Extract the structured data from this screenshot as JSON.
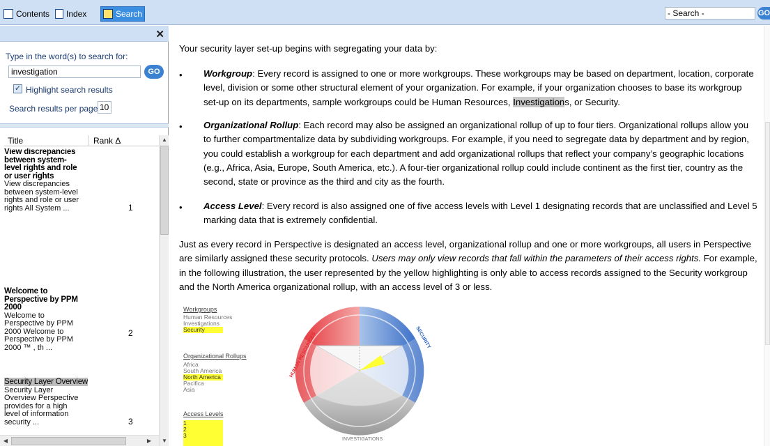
{
  "toolbar": {
    "tabs": [
      {
        "label": "Contents",
        "active": false,
        "icon": "book-icon"
      },
      {
        "label": "Index",
        "active": false,
        "icon": "index-icon"
      },
      {
        "label": "Search",
        "active": true,
        "icon": "search-icon"
      }
    ],
    "search_placeholder": "- Search -",
    "go_label": "GO"
  },
  "search_pane": {
    "prompt": "Type in the word(s) to search for:",
    "query": "investigation",
    "go_label": "GO",
    "highlight_label": "Highlight search results",
    "highlight_checked": true,
    "per_page_label": "Search results per page",
    "per_page_value": "10",
    "columns": {
      "title": "Title",
      "rank": "Rank Δ"
    },
    "results": [
      {
        "title": "View discrepancies between system-level rights and role or user rights",
        "desc": "View discrepancies between system-level rights and role or user rights All System ...",
        "rank": "1"
      },
      {
        "title": "Welcome to Perspective by PPM 2000",
        "desc": "Welcome to Perspective by PPM 2000 Welcome to Perspective by PPM 2000 ™ , th ...",
        "rank": "2"
      },
      {
        "title": "Security Layer Overview",
        "desc": "Security Layer Overview Perspective provides for a high level of information security ...",
        "rank": "3"
      }
    ]
  },
  "article": {
    "intro": "Your security layer set-up begins with segregating your data by:",
    "bullets": [
      {
        "term": "Workgroup",
        "text_a": ": Every record is assigned to one or more workgroups. These workgroups may be based on department, location, corporate level, division or some other structural element of your organization. For example, if your organization chooses to base its workgroup set-up on its departments, sample workgroups could be Human Resources, ",
        "highlight": "Investigation",
        "text_b": "s, or Security."
      },
      {
        "term": "Organizational Rollup",
        "text_a": ": Each record may also be assigned an organizational rollup of up to four tiers. Organizational rollups allow you to further compartmentalize data by subdividing workgroups. For example, if you need to segregate data by department and by region, you could establish a workgroup for each department and add organizational rollups that reflect your company’s geographic locations (e.g., Africa, Asia, Europe, South America, etc.). A four-tier organizational rollup could include continent as the first tier, country as the second, state or province as the third and city as the fourth.",
        "highlight": "",
        "text_b": ""
      },
      {
        "term": "Access Level",
        "text_a": ": Every record is also assigned one of five access levels with Level 1 designating records that are unclassified and Level 5 marking data that is extremely confidential.",
        "highlight": "",
        "text_b": ""
      }
    ],
    "para_a": "Just as every record in Perspective is designated an access level, organizational rollup and one or more workgroups, all users in Perspective are similarly assigned these security protocols. ",
    "para_em": "Users may only view records that fall within the parameters of their access rights.",
    "para_b": " For example, in the following illustration, the user represented by the yellow highlighting is only able to access records assigned to the Security workgroup and the North America organizational rollup, with an access level of 3 or less."
  },
  "illustration": {
    "workgroups_head": "Workgroups",
    "workgroups": [
      "Human Resources",
      "Investigations",
      "Security"
    ],
    "rollups_head": "Organizational Rollups",
    "rollups": [
      "Africa",
      "South America",
      "North America",
      "Pacifica",
      "Asia"
    ],
    "levels_head": "Access Levels",
    "levels": [
      "1",
      "2",
      "3"
    ],
    "wheel_labels": {
      "left": "HUMAN RESOURCES",
      "right": "SECURITY",
      "bottom": "INVESTIGATIONS"
    },
    "colors": {
      "red": "#e3292f",
      "blue": "#2a63c4",
      "gray": "#9a9a9a",
      "yellow": "#ffff33"
    }
  }
}
